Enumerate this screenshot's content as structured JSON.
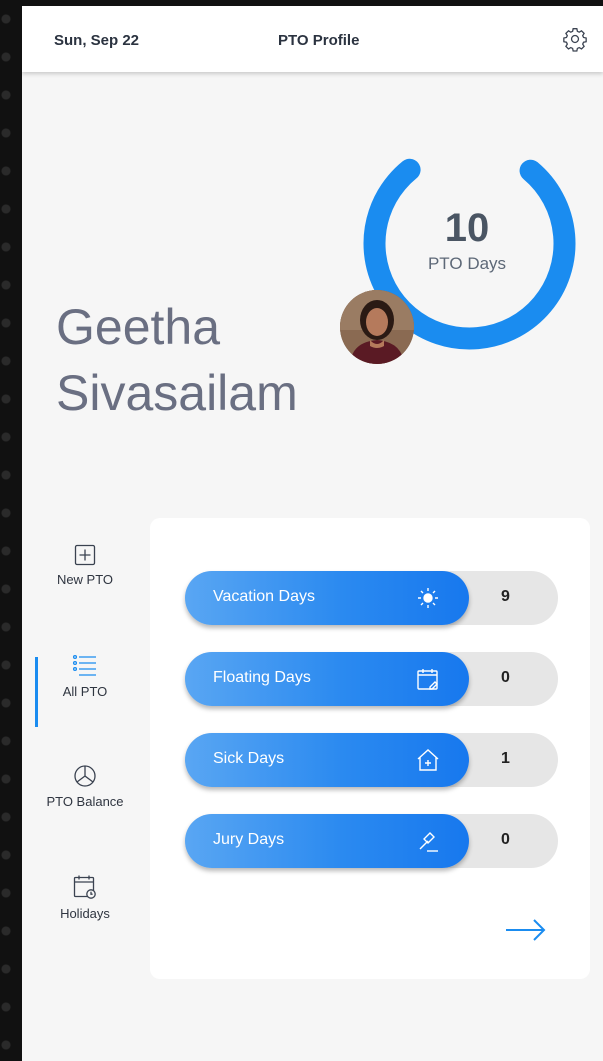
{
  "header": {
    "date": "Sun, Sep 22",
    "title": "PTO Profile",
    "settings_icon": "gear-icon"
  },
  "profile": {
    "pto_days_value": "10",
    "pto_days_label": "PTO Days",
    "pto_ring_fill_fraction": 0.78,
    "first_name": "Geetha",
    "last_name": "Sivasailam",
    "accent_color": "#1a8cf0"
  },
  "nav": {
    "items": [
      {
        "label": "New PTO",
        "icon": "plus-square-icon",
        "active": false
      },
      {
        "label": "All PTO",
        "icon": "list-icon",
        "active": true
      },
      {
        "label": "PTO Balance",
        "icon": "pie-chart-icon",
        "active": false
      },
      {
        "label": "Holidays",
        "icon": "calendar-icon",
        "active": false
      }
    ]
  },
  "balances": [
    {
      "label": "Vacation Days",
      "icon": "sun-icon",
      "value": "9"
    },
    {
      "label": "Floating Days",
      "icon": "calendar-edit-icon",
      "value": "0"
    },
    {
      "label": "Sick Days",
      "icon": "home-medical-icon",
      "value": "1"
    },
    {
      "label": "Jury Days",
      "icon": "gavel-icon",
      "value": "0"
    }
  ],
  "next_icon": "arrow-right-icon"
}
